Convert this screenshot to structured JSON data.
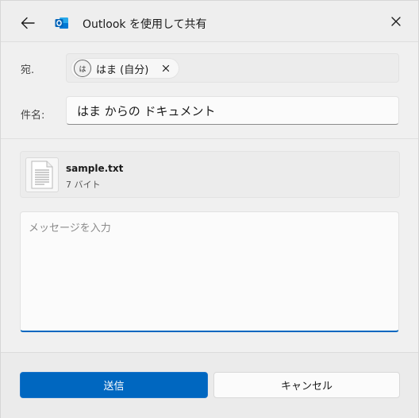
{
  "window": {
    "title": "Outlook を使用して共有",
    "app_icon": "outlook-logo",
    "accent_color": "#0067c0"
  },
  "to": {
    "label": "宛.",
    "recipient": {
      "avatar_initial": "は",
      "name": "はま (自分)"
    }
  },
  "subject": {
    "label": "件名:",
    "value": "はま からの ドキュメント"
  },
  "attachment": {
    "file_name": "sample.txt",
    "file_size": "7 バイト",
    "icon": "text-file-icon"
  },
  "message": {
    "value": "",
    "placeholder": "メッセージを入力"
  },
  "footer": {
    "send_label": "送信",
    "cancel_label": "キャンセル"
  }
}
